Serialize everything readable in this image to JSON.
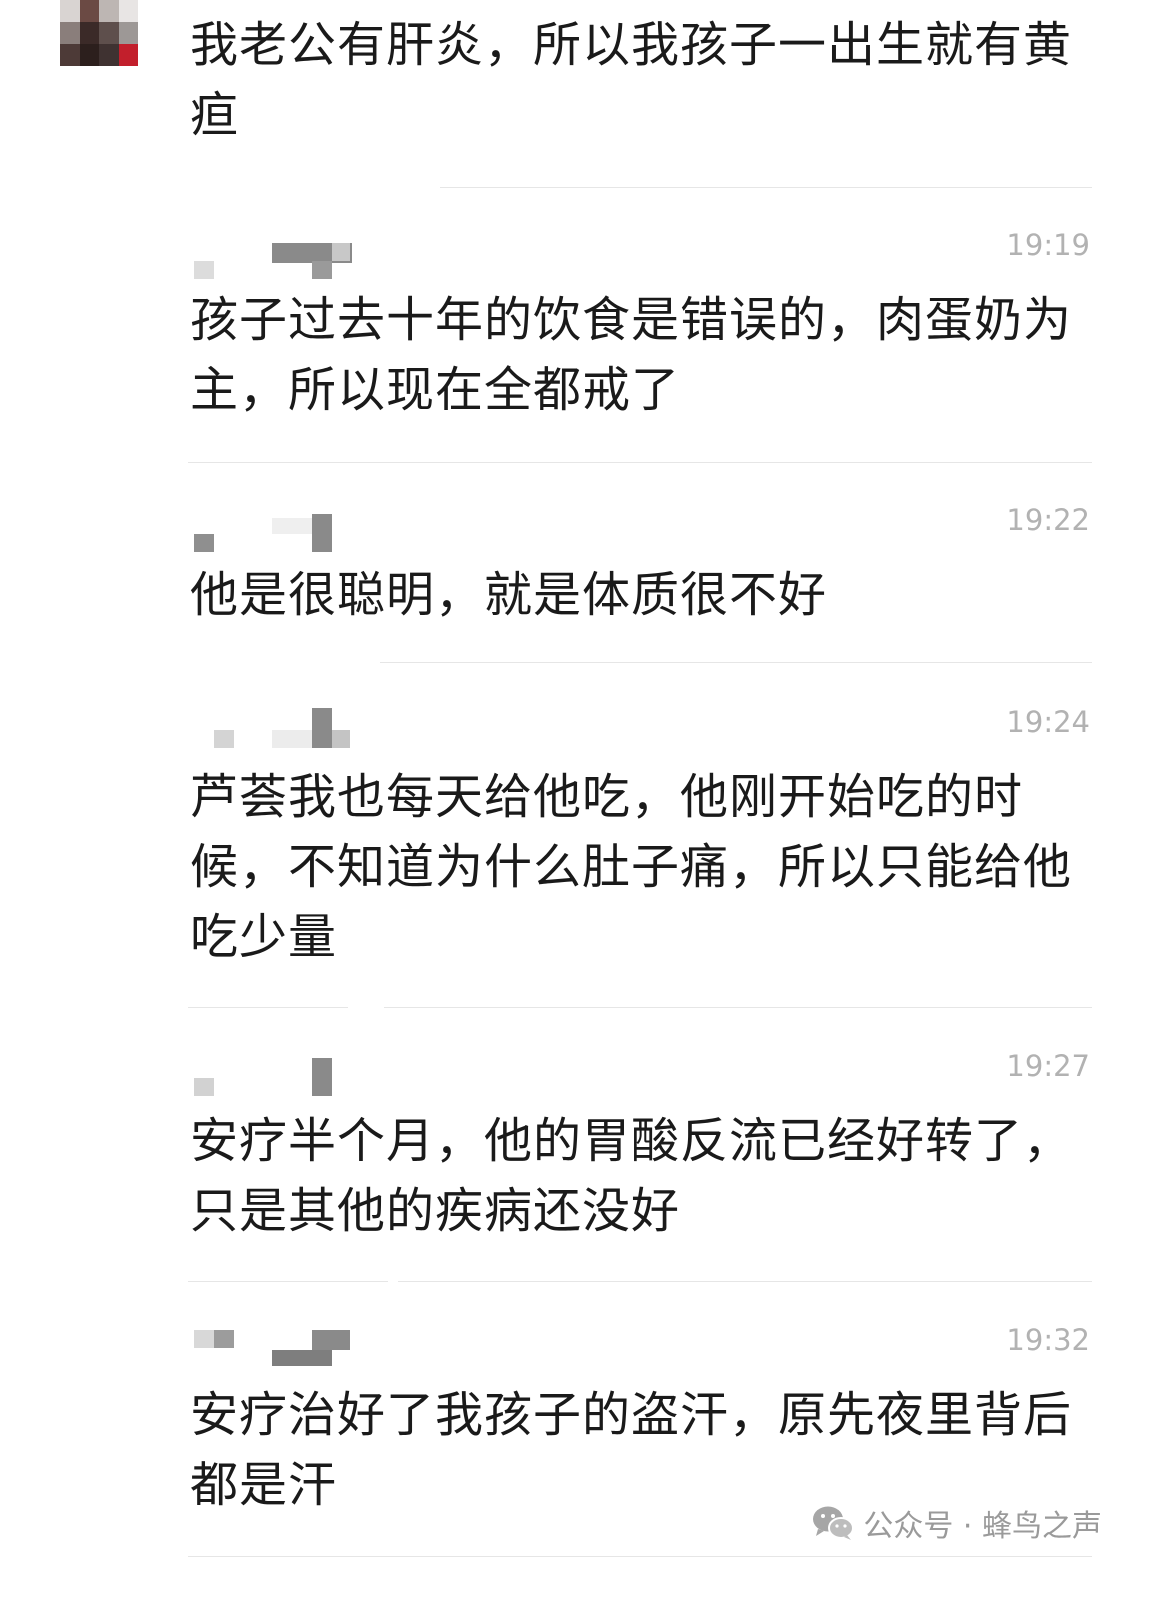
{
  "messages": [
    {
      "time": "",
      "text": "我老公有肝炎，所以我孩子一出生就有黄疸"
    },
    {
      "time": "19:19",
      "text": "孩子过去十年的饮食是错误的，肉蛋奶为主，所以现在全都戒了"
    },
    {
      "time": "19:22",
      "text": "他是很聪明，就是体质很不好"
    },
    {
      "time": "19:24",
      "text": "芦荟我也每天给他吃，他刚开始吃的时候，不知道为什么肚子痛，所以只能给他吃少量"
    },
    {
      "time": "19:27",
      "text": "安疗半个月，他的胃酸反流已经好转了，只是其他的疾病还没好"
    },
    {
      "time": "19:32",
      "text": "安疗治好了我孩子的盗汗，原先夜里背后都是汗"
    }
  ],
  "watermark": {
    "label": "公众号 · 蜂鸟之声",
    "icon": "wechat-icon"
  }
}
